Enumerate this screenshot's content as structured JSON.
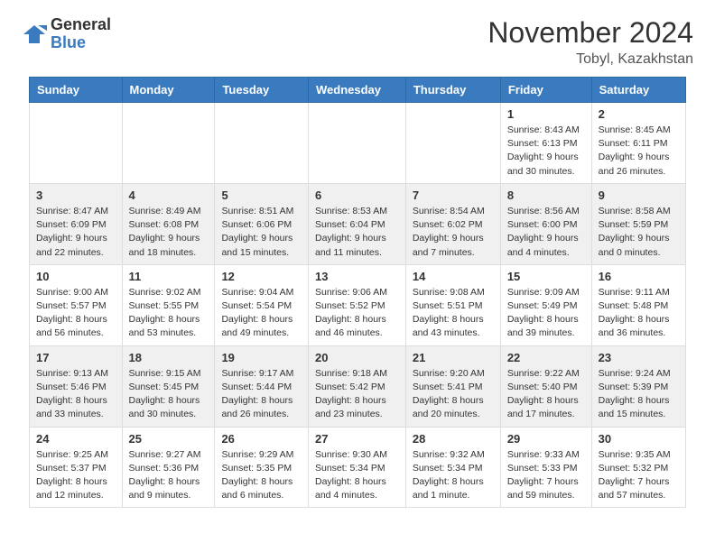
{
  "logo": {
    "general": "General",
    "blue": "Blue"
  },
  "title": {
    "month": "November 2024",
    "location": "Tobyl, Kazakhstan"
  },
  "weekdays": [
    "Sunday",
    "Monday",
    "Tuesday",
    "Wednesday",
    "Thursday",
    "Friday",
    "Saturday"
  ],
  "weeks": [
    [
      {
        "day": "",
        "info": ""
      },
      {
        "day": "",
        "info": ""
      },
      {
        "day": "",
        "info": ""
      },
      {
        "day": "",
        "info": ""
      },
      {
        "day": "",
        "info": ""
      },
      {
        "day": "1",
        "info": "Sunrise: 8:43 AM\nSunset: 6:13 PM\nDaylight: 9 hours and 30 minutes."
      },
      {
        "day": "2",
        "info": "Sunrise: 8:45 AM\nSunset: 6:11 PM\nDaylight: 9 hours and 26 minutes."
      }
    ],
    [
      {
        "day": "3",
        "info": "Sunrise: 8:47 AM\nSunset: 6:09 PM\nDaylight: 9 hours and 22 minutes."
      },
      {
        "day": "4",
        "info": "Sunrise: 8:49 AM\nSunset: 6:08 PM\nDaylight: 9 hours and 18 minutes."
      },
      {
        "day": "5",
        "info": "Sunrise: 8:51 AM\nSunset: 6:06 PM\nDaylight: 9 hours and 15 minutes."
      },
      {
        "day": "6",
        "info": "Sunrise: 8:53 AM\nSunset: 6:04 PM\nDaylight: 9 hours and 11 minutes."
      },
      {
        "day": "7",
        "info": "Sunrise: 8:54 AM\nSunset: 6:02 PM\nDaylight: 9 hours and 7 minutes."
      },
      {
        "day": "8",
        "info": "Sunrise: 8:56 AM\nSunset: 6:00 PM\nDaylight: 9 hours and 4 minutes."
      },
      {
        "day": "9",
        "info": "Sunrise: 8:58 AM\nSunset: 5:59 PM\nDaylight: 9 hours and 0 minutes."
      }
    ],
    [
      {
        "day": "10",
        "info": "Sunrise: 9:00 AM\nSunset: 5:57 PM\nDaylight: 8 hours and 56 minutes."
      },
      {
        "day": "11",
        "info": "Sunrise: 9:02 AM\nSunset: 5:55 PM\nDaylight: 8 hours and 53 minutes."
      },
      {
        "day": "12",
        "info": "Sunrise: 9:04 AM\nSunset: 5:54 PM\nDaylight: 8 hours and 49 minutes."
      },
      {
        "day": "13",
        "info": "Sunrise: 9:06 AM\nSunset: 5:52 PM\nDaylight: 8 hours and 46 minutes."
      },
      {
        "day": "14",
        "info": "Sunrise: 9:08 AM\nSunset: 5:51 PM\nDaylight: 8 hours and 43 minutes."
      },
      {
        "day": "15",
        "info": "Sunrise: 9:09 AM\nSunset: 5:49 PM\nDaylight: 8 hours and 39 minutes."
      },
      {
        "day": "16",
        "info": "Sunrise: 9:11 AM\nSunset: 5:48 PM\nDaylight: 8 hours and 36 minutes."
      }
    ],
    [
      {
        "day": "17",
        "info": "Sunrise: 9:13 AM\nSunset: 5:46 PM\nDaylight: 8 hours and 33 minutes."
      },
      {
        "day": "18",
        "info": "Sunrise: 9:15 AM\nSunset: 5:45 PM\nDaylight: 8 hours and 30 minutes."
      },
      {
        "day": "19",
        "info": "Sunrise: 9:17 AM\nSunset: 5:44 PM\nDaylight: 8 hours and 26 minutes."
      },
      {
        "day": "20",
        "info": "Sunrise: 9:18 AM\nSunset: 5:42 PM\nDaylight: 8 hours and 23 minutes."
      },
      {
        "day": "21",
        "info": "Sunrise: 9:20 AM\nSunset: 5:41 PM\nDaylight: 8 hours and 20 minutes."
      },
      {
        "day": "22",
        "info": "Sunrise: 9:22 AM\nSunset: 5:40 PM\nDaylight: 8 hours and 17 minutes."
      },
      {
        "day": "23",
        "info": "Sunrise: 9:24 AM\nSunset: 5:39 PM\nDaylight: 8 hours and 15 minutes."
      }
    ],
    [
      {
        "day": "24",
        "info": "Sunrise: 9:25 AM\nSunset: 5:37 PM\nDaylight: 8 hours and 12 minutes."
      },
      {
        "day": "25",
        "info": "Sunrise: 9:27 AM\nSunset: 5:36 PM\nDaylight: 8 hours and 9 minutes."
      },
      {
        "day": "26",
        "info": "Sunrise: 9:29 AM\nSunset: 5:35 PM\nDaylight: 8 hours and 6 minutes."
      },
      {
        "day": "27",
        "info": "Sunrise: 9:30 AM\nSunset: 5:34 PM\nDaylight: 8 hours and 4 minutes."
      },
      {
        "day": "28",
        "info": "Sunrise: 9:32 AM\nSunset: 5:34 PM\nDaylight: 8 hours and 1 minute."
      },
      {
        "day": "29",
        "info": "Sunrise: 9:33 AM\nSunset: 5:33 PM\nDaylight: 7 hours and 59 minutes."
      },
      {
        "day": "30",
        "info": "Sunrise: 9:35 AM\nSunset: 5:32 PM\nDaylight: 7 hours and 57 minutes."
      }
    ]
  ]
}
